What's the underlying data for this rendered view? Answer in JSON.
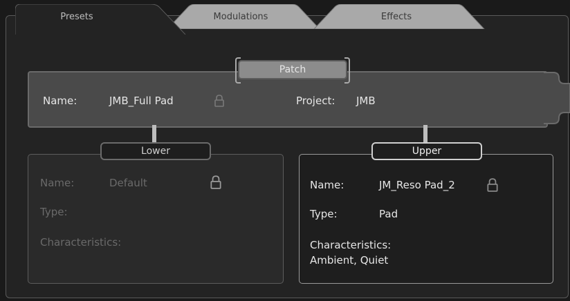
{
  "tabs": [
    {
      "label": "Presets",
      "active": true
    },
    {
      "label": "Modulations",
      "active": false
    },
    {
      "label": "Effects",
      "active": false
    }
  ],
  "patch": {
    "title": "Patch",
    "name_label": "Name:",
    "name_value": "JMB_Full Pad",
    "project_label": "Project:",
    "project_value": "JMB"
  },
  "lower": {
    "title": "Lower",
    "name_label": "Name:",
    "name_value": "Default",
    "type_label": "Type:",
    "type_value": "",
    "characteristics_label": "Characteristics:",
    "characteristics_value": ""
  },
  "upper": {
    "title": "Upper",
    "name_label": "Name:",
    "name_value": "JM_Reso Pad_2",
    "type_label": "Type:",
    "type_value": "Pad",
    "characteristics_label": "Characteristics:",
    "characteristics_value": "Ambient, Quiet"
  },
  "icons": [
    "lock-icon"
  ],
  "colors": {
    "background": "#1a1a1a",
    "panel": "#4a4a4a",
    "patch_title": "#8c8c8c",
    "inactive_tab": "#a9a9a9"
  }
}
